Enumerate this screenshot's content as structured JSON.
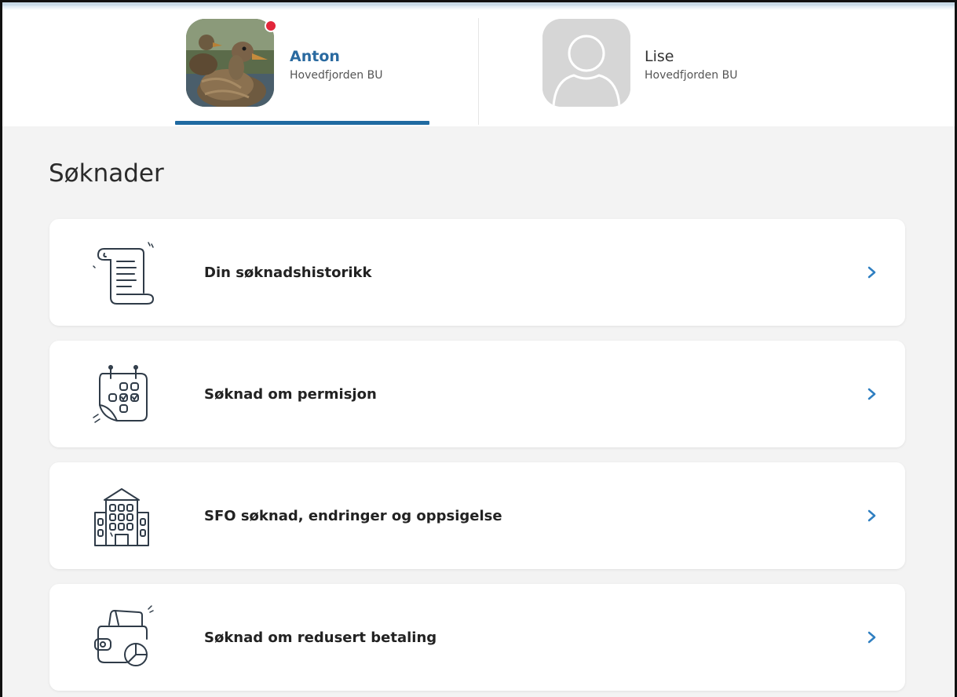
{
  "children": [
    {
      "name": "Anton",
      "school": "Hovedfjorden BU",
      "active": true,
      "has_notification": true
    },
    {
      "name": "Lise",
      "school": "Hovedfjorden BU",
      "active": false,
      "has_notification": false
    }
  ],
  "page": {
    "title": "Søknader"
  },
  "items": [
    {
      "label": "Din søknadshistorikk",
      "icon": "scroll-icon"
    },
    {
      "label": "Søknad om permisjon",
      "icon": "calendar-check-icon"
    },
    {
      "label": "SFO søknad, endringer og oppsigelse",
      "icon": "school-building-icon"
    },
    {
      "label": "Søknad om redusert betaling",
      "icon": "wallet-chart-icon"
    }
  ],
  "colors": {
    "accent": "#1f6aa1",
    "active_name": "#2a6aa0",
    "notification": "#e2263a",
    "background": "#f3f3f3",
    "chevron": "#2f7fc1"
  }
}
